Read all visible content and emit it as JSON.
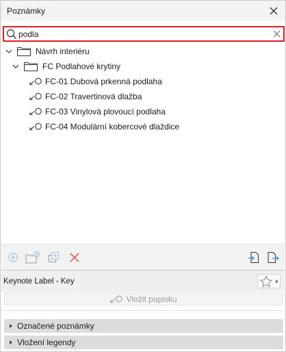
{
  "window": {
    "title": "Poznámky"
  },
  "search": {
    "value": "podla"
  },
  "tree": {
    "root": {
      "label": "Návrh interiéru"
    },
    "group": {
      "label": "FC Podlahové krytiny"
    },
    "items": [
      {
        "label": "FC-01 Dubová prkenná podlaha"
      },
      {
        "label": "FC-02 Travertinová dlažba"
      },
      {
        "label": "FC-03 Vinylová plovoucí podlaha"
      },
      {
        "label": "FC-04 Modulární kobercové dlaždice"
      }
    ]
  },
  "toolbar": {
    "icons": [
      "add-keynote-icon",
      "new-folder-icon",
      "duplicate-icon",
      "delete-icon",
      "import-icon",
      "export-icon"
    ]
  },
  "keynote_label": {
    "title": "Keynote Label - Key",
    "insert_label": "Vložit popisku"
  },
  "sections": [
    {
      "label": "Označené poznámky"
    },
    {
      "label": "Vložení legendy"
    }
  ],
  "colors": {
    "search_border": "#e01e1e",
    "delete_icon": "#e15b5b",
    "action_icon": "#5a9bd5"
  }
}
